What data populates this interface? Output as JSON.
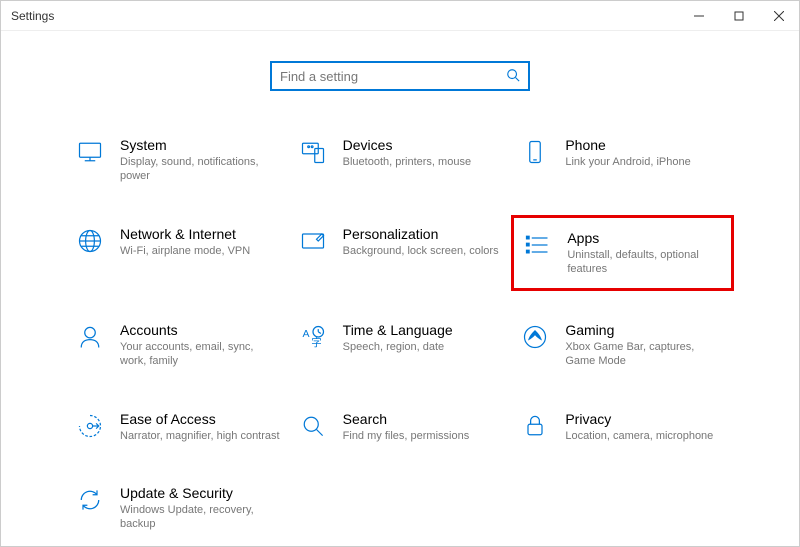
{
  "window": {
    "title": "Settings"
  },
  "search": {
    "placeholder": "Find a setting"
  },
  "tiles": {
    "system": {
      "title": "System",
      "desc": "Display, sound, notifications, power"
    },
    "devices": {
      "title": "Devices",
      "desc": "Bluetooth, printers, mouse"
    },
    "phone": {
      "title": "Phone",
      "desc": "Link your Android, iPhone"
    },
    "network": {
      "title": "Network & Internet",
      "desc": "Wi-Fi, airplane mode, VPN"
    },
    "personalization": {
      "title": "Personalization",
      "desc": "Background, lock screen, colors"
    },
    "apps": {
      "title": "Apps",
      "desc": "Uninstall, defaults, optional features"
    },
    "accounts": {
      "title": "Accounts",
      "desc": "Your accounts, email, sync, work, family"
    },
    "time": {
      "title": "Time & Language",
      "desc": "Speech, region, date"
    },
    "gaming": {
      "title": "Gaming",
      "desc": "Xbox Game Bar, captures, Game Mode"
    },
    "ease": {
      "title": "Ease of Access",
      "desc": "Narrator, magnifier, high contrast"
    },
    "search_tile": {
      "title": "Search",
      "desc": "Find my files, permissions"
    },
    "privacy": {
      "title": "Privacy",
      "desc": "Location, camera, microphone"
    },
    "update": {
      "title": "Update & Security",
      "desc": "Windows Update, recovery, backup"
    }
  }
}
